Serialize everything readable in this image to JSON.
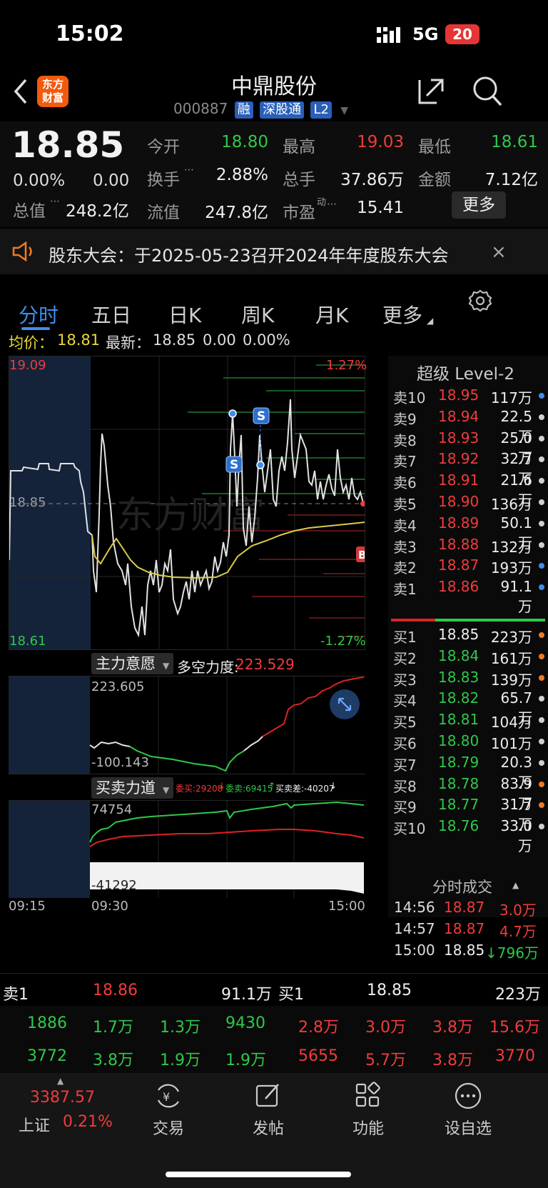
{
  "status": {
    "time": "15:02",
    "network": "5G",
    "battery": "20"
  },
  "header": {
    "logo_top": "东方",
    "logo_bottom": "财富",
    "name": "中鼎股份",
    "code": "000887",
    "badges": [
      "融",
      "深股通",
      "L2"
    ]
  },
  "quote": {
    "price": "18.85",
    "change_pct": "0.00%",
    "change": "0.00",
    "open_label": "今开",
    "open": "18.80",
    "high_label": "最高",
    "high": "19.03",
    "low_label": "最低",
    "low": "18.61",
    "turnover_label": "换手",
    "turnover": "2.88%",
    "volume_label": "总手",
    "volume": "37.86万",
    "amount_label": "金额",
    "amount": "7.12亿",
    "mktcap_label": "总值",
    "mktcap": "248.2亿",
    "float_label": "流值",
    "float": "247.8亿",
    "pe_label": "市盈",
    "pe_sup": "动",
    "pe": "15.41",
    "more_button": "更多"
  },
  "notice": {
    "text": "股东大会：于2025-05-23召开2024年年度股东大会"
  },
  "tabs": [
    "分时",
    "五日",
    "日K",
    "周K",
    "月K",
    "更多"
  ],
  "info_line": {
    "avg_label": "均价：",
    "avg": "18.81",
    "latest_label": "最新：",
    "latest": "18.85",
    "chg": "0.00",
    "pct": "0.00%"
  },
  "intraday": {
    "y_top": "19.09",
    "y_mid": "18.85",
    "y_bottom": "18.61",
    "pct_top": "1.27%",
    "pct_bottom": "-1.27%",
    "watermark": "东方财富",
    "marker_s": "S",
    "marker_b": "B"
  },
  "indicator1": {
    "title": "主力意愿",
    "label": "多空力度:",
    "value": "223.529",
    "y_top": "223.605",
    "y_bottom": "-100.143"
  },
  "indicator2": {
    "title": "买卖力道",
    "buy_label": "委买:29208",
    "sell_label": "委卖:69415",
    "diff_label": "买卖差:-40207",
    "y_top": "74754",
    "y_bottom": "-41292"
  },
  "time_axis": [
    "09:15",
    "09:30",
    "15:00"
  ],
  "orderbook": {
    "title": "超级 Level-2",
    "asks": [
      {
        "label": "卖10",
        "price": "18.95",
        "vol": "117万",
        "dot": "#3d8ef0"
      },
      {
        "label": "卖9",
        "price": "18.94",
        "vol": "22.5万",
        "dot": "#cfcfcf"
      },
      {
        "label": "卖8",
        "price": "18.93",
        "vol": "25.0万",
        "dot": "#cfcfcf"
      },
      {
        "label": "卖7",
        "price": "18.92",
        "vol": "32.7万",
        "dot": "#cfcfcf"
      },
      {
        "label": "卖6",
        "price": "18.91",
        "vol": "21.6万",
        "dot": "#cfcfcf"
      },
      {
        "label": "卖5",
        "price": "18.90",
        "vol": "136万",
        "dot": "#cfcfcf"
      },
      {
        "label": "卖4",
        "price": "18.89",
        "vol": "50.1万",
        "dot": "#cfcfcf"
      },
      {
        "label": "卖3",
        "price": "18.88",
        "vol": "132万",
        "dot": "#cfcfcf"
      },
      {
        "label": "卖2",
        "price": "18.87",
        "vol": "193万",
        "dot": "#3d8ef0"
      },
      {
        "label": "卖1",
        "price": "18.86",
        "vol": "91.1万",
        "dot": "#3d8ef0"
      }
    ],
    "bids": [
      {
        "label": "买1",
        "price": "18.85",
        "vol": "223万",
        "dot": "#f07a22"
      },
      {
        "label": "买2",
        "price": "18.84",
        "vol": "161万",
        "dot": "#f07a22"
      },
      {
        "label": "买3",
        "price": "18.83",
        "vol": "139万",
        "dot": "#f07a22"
      },
      {
        "label": "买4",
        "price": "18.82",
        "vol": "65.7万",
        "dot": "#cfcfcf"
      },
      {
        "label": "买5",
        "price": "18.81",
        "vol": "104万",
        "dot": "#cfcfcf"
      },
      {
        "label": "买6",
        "price": "18.80",
        "vol": "101万",
        "dot": "#cfcfcf"
      },
      {
        "label": "买7",
        "price": "18.79",
        "vol": "20.3万",
        "dot": "#cfcfcf"
      },
      {
        "label": "买8",
        "price": "18.78",
        "vol": "83.9万",
        "dot": "#f07a22"
      },
      {
        "label": "买9",
        "price": "18.77",
        "vol": "31.7万",
        "dot": "#f07a22"
      },
      {
        "label": "买10",
        "price": "18.76",
        "vol": "33.0万",
        "dot": "#cfcfcf"
      }
    ],
    "trades_title": "分时成交",
    "trades": [
      {
        "time": "14:56",
        "price": "18.87",
        "vol": "3.0万"
      },
      {
        "time": "14:57",
        "price": "18.87",
        "vol": "4.7万"
      },
      {
        "time": "15:00",
        "price": "18.85",
        "vol": "↓796万"
      }
    ]
  },
  "bottom_book": {
    "sell_label": "卖1",
    "sell_price": "18.86",
    "sell_vol": "91.1万",
    "buy_label": "买1",
    "buy_price": "18.85",
    "buy_vol": "223万",
    "sell_rows": [
      [
        "1886",
        "1.7万",
        "1.3万",
        "9430"
      ],
      [
        "3772",
        "3.8万",
        "1.9万",
        "1.9万"
      ]
    ],
    "buy_rows": [
      [
        "2.8万",
        "3.0万",
        "3.8万",
        "15.6万"
      ],
      [
        "5655",
        "5.7万",
        "3.8万",
        "3770"
      ]
    ]
  },
  "nav": {
    "index_value": "3387.57",
    "index_name": "上证",
    "index_pct": "0.21%",
    "items": [
      "交易",
      "发帖",
      "功能",
      "设自选"
    ]
  }
}
